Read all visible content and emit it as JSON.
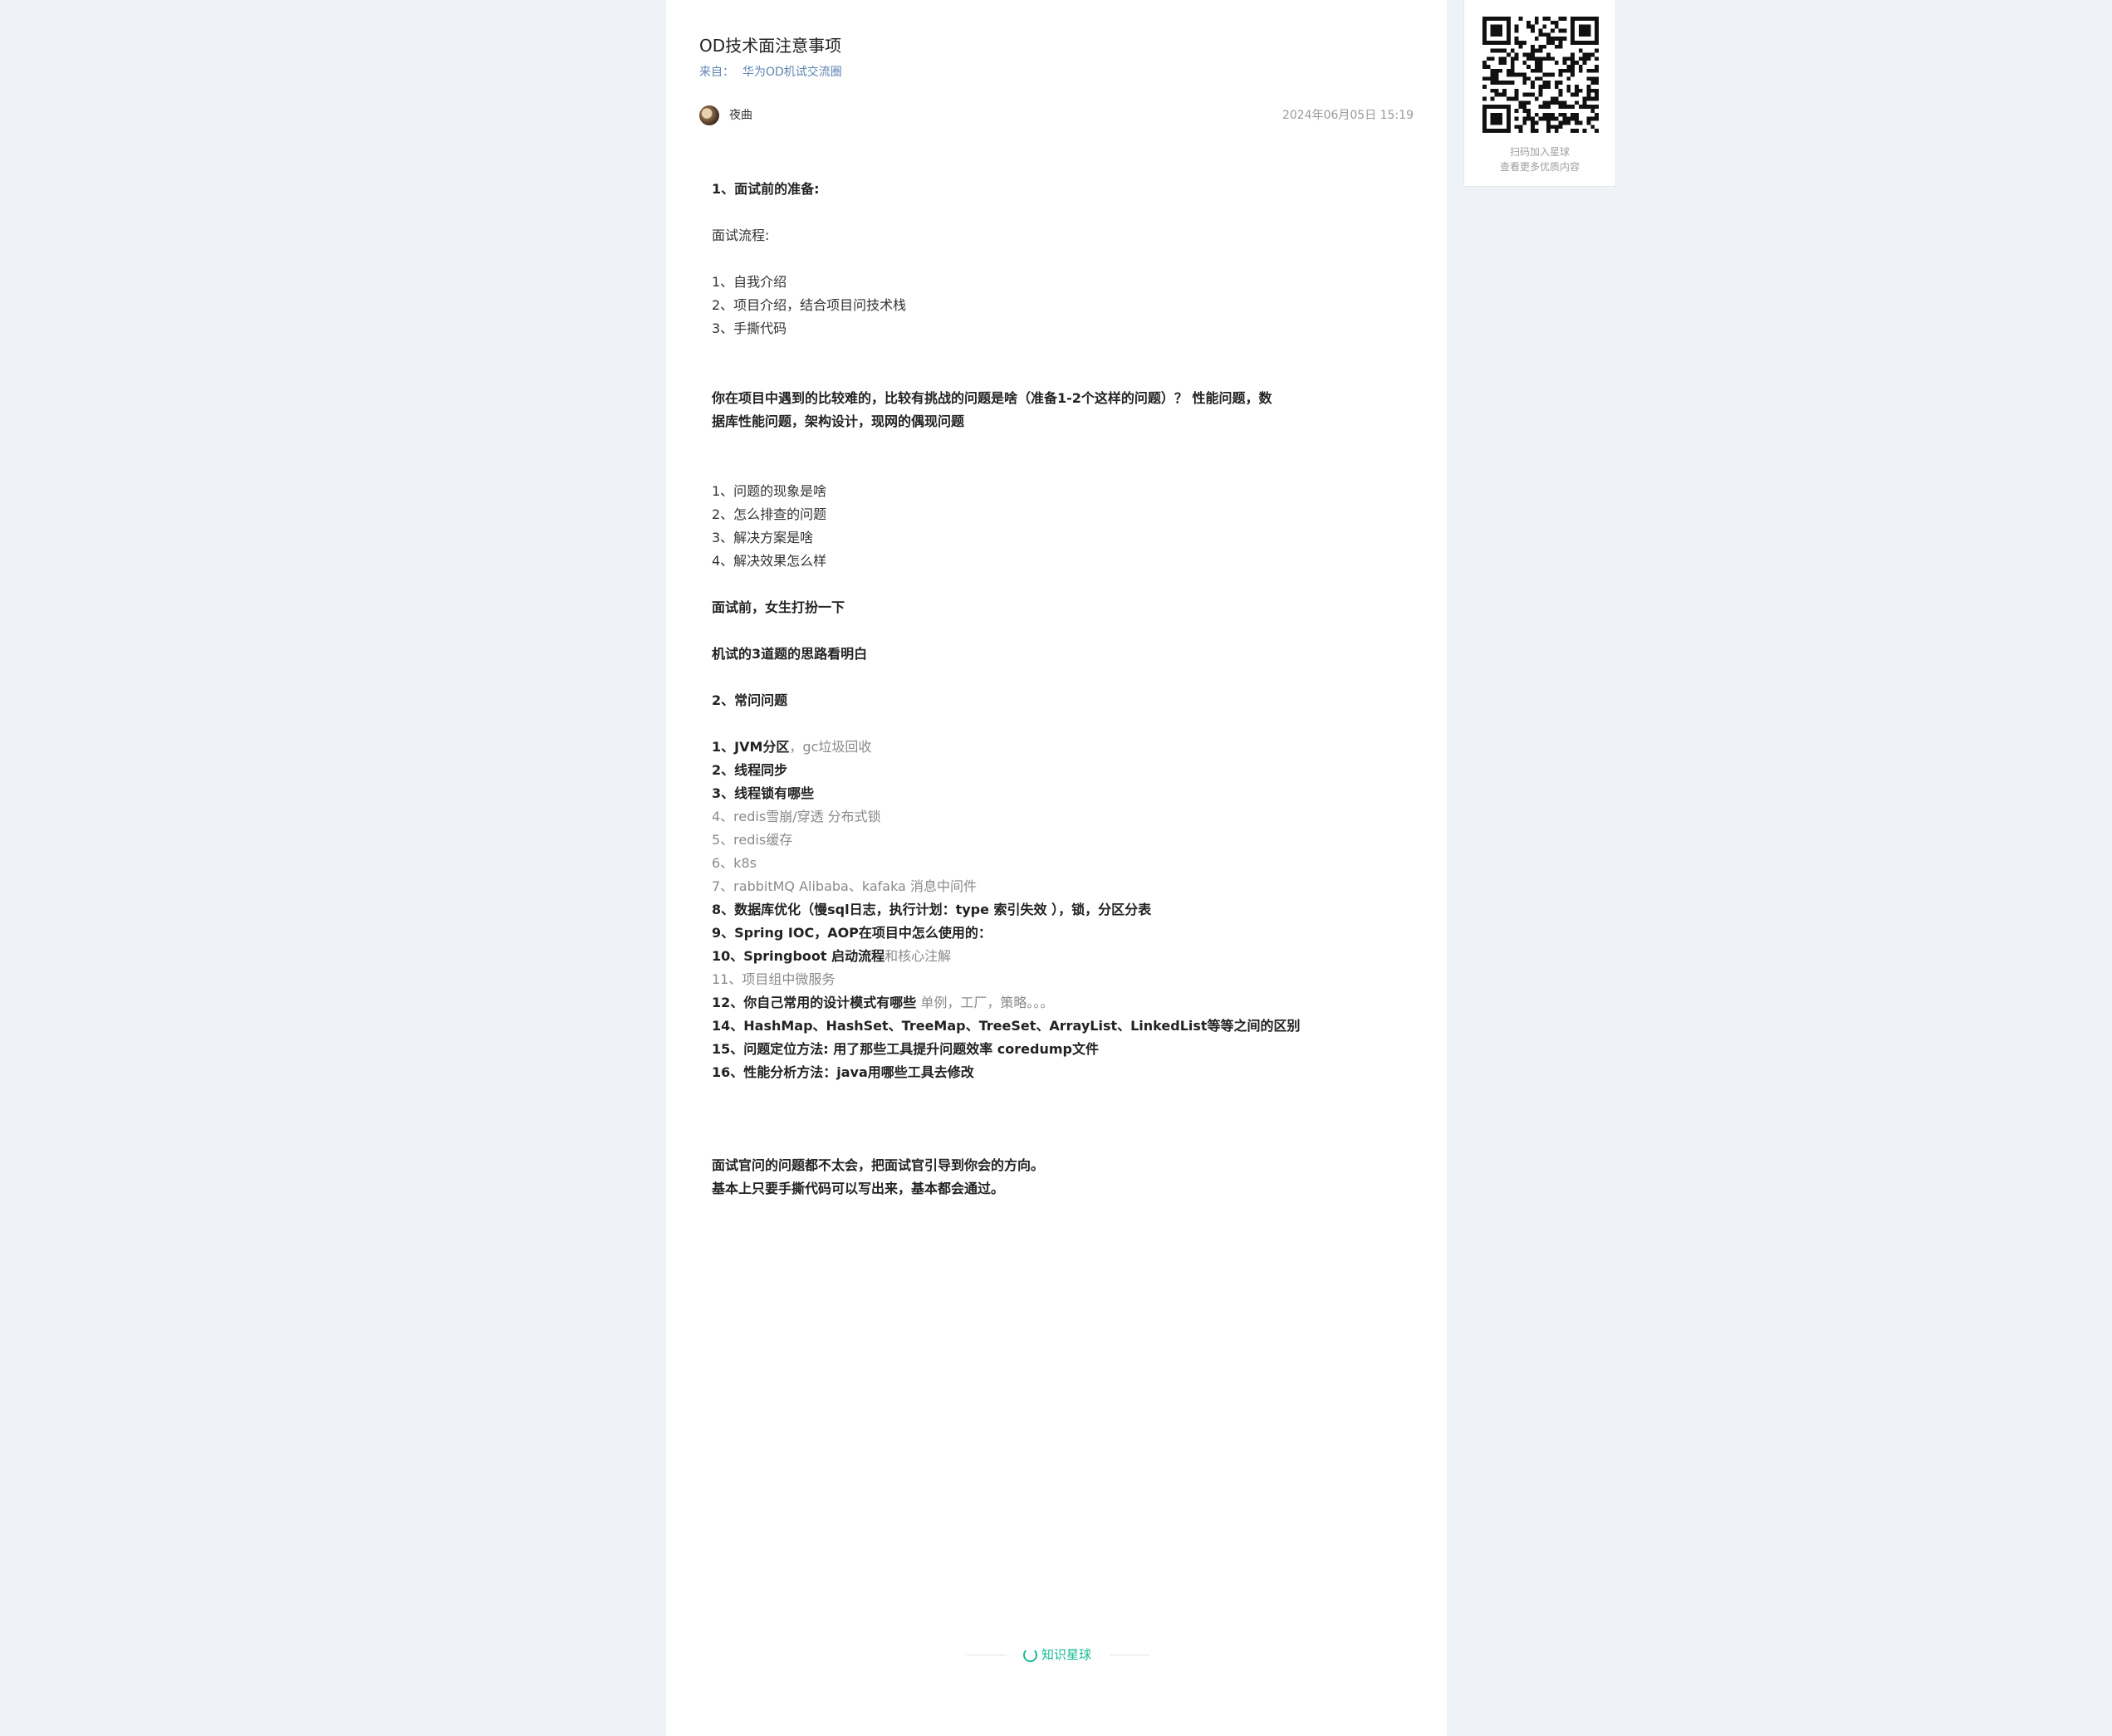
{
  "article": {
    "title": "OD技术面注意事项",
    "source_prefix": "来自：",
    "source_name": "华为OD机试交流圈",
    "author": "夜曲",
    "date": "2024年06月05日 15:19",
    "content": {
      "section1_heading": "1、面试前的准备:",
      "process_label": "面试流程:",
      "process_steps": [
        "1、自我介绍",
        "2、项目介绍，结合项目问技术栈",
        "3、手撕代码"
      ],
      "challenge_question": "你在项目中遇到的比较难的，比较有挑战的问题是啥（准备1-2个这样的问题）？ 性能问题，数据库性能问题，架构设计，现网的偶现问题",
      "challenge_points": [
        "1、问题的现象是啥",
        "2、怎么排查的问题",
        "3、解决方案是啥",
        "4、解决效果怎么样"
      ],
      "tip_dress": "面试前，女生打扮一下",
      "tip_exam": "机试的3道题的思路看明白",
      "section2_heading": "2、常问问题",
      "q1_bold": "1、JVM分区",
      "q1_rest": "，gc垃圾回收",
      "q2": "2、线程同步",
      "q3": "3、线程锁有哪些",
      "q4": "4、redis雪崩/穿透 分布式锁",
      "q5": "5、redis缓存",
      "q6": "6、k8s",
      "q7": "7、rabbitMQ Alibaba、kafaka 消息中间件",
      "q8": "8、数据库优化（慢sql日志，执行计划：type 索引失效 ），锁，分区分表",
      "q9": "9、Spring IOC，AOP在项目中怎么使用的：",
      "q10_bold": "10、Springboot 启动流程",
      "q10_rest": "和核心注解",
      "q11": "11、项目组中微服务",
      "q12_bold": "12、你自己常用的设计模式有哪些",
      "q12_rest": " 单例，工厂，策略。。。",
      "q14": "14、HashMap、HashSet、TreeMap、TreeSet、ArrayList、LinkedList等等之间的区别",
      "q15": "15、问题定位方法: 用了那些工具提升问题效率 coredump文件",
      "q16": "16、性能分析方法：java用哪些工具去修改",
      "closing_1": "面试官问的问题都不太会，把面试官引导到你会的方向。",
      "closing_2": "基本上只要手撕代码可以写出来，基本都会通过。"
    }
  },
  "footer": {
    "brand": "知识星球",
    "brand_color": "#16b998"
  },
  "sidebar": {
    "qr_caption_1": "扫码加入星球",
    "qr_caption_2": "查看更多优质内容"
  }
}
